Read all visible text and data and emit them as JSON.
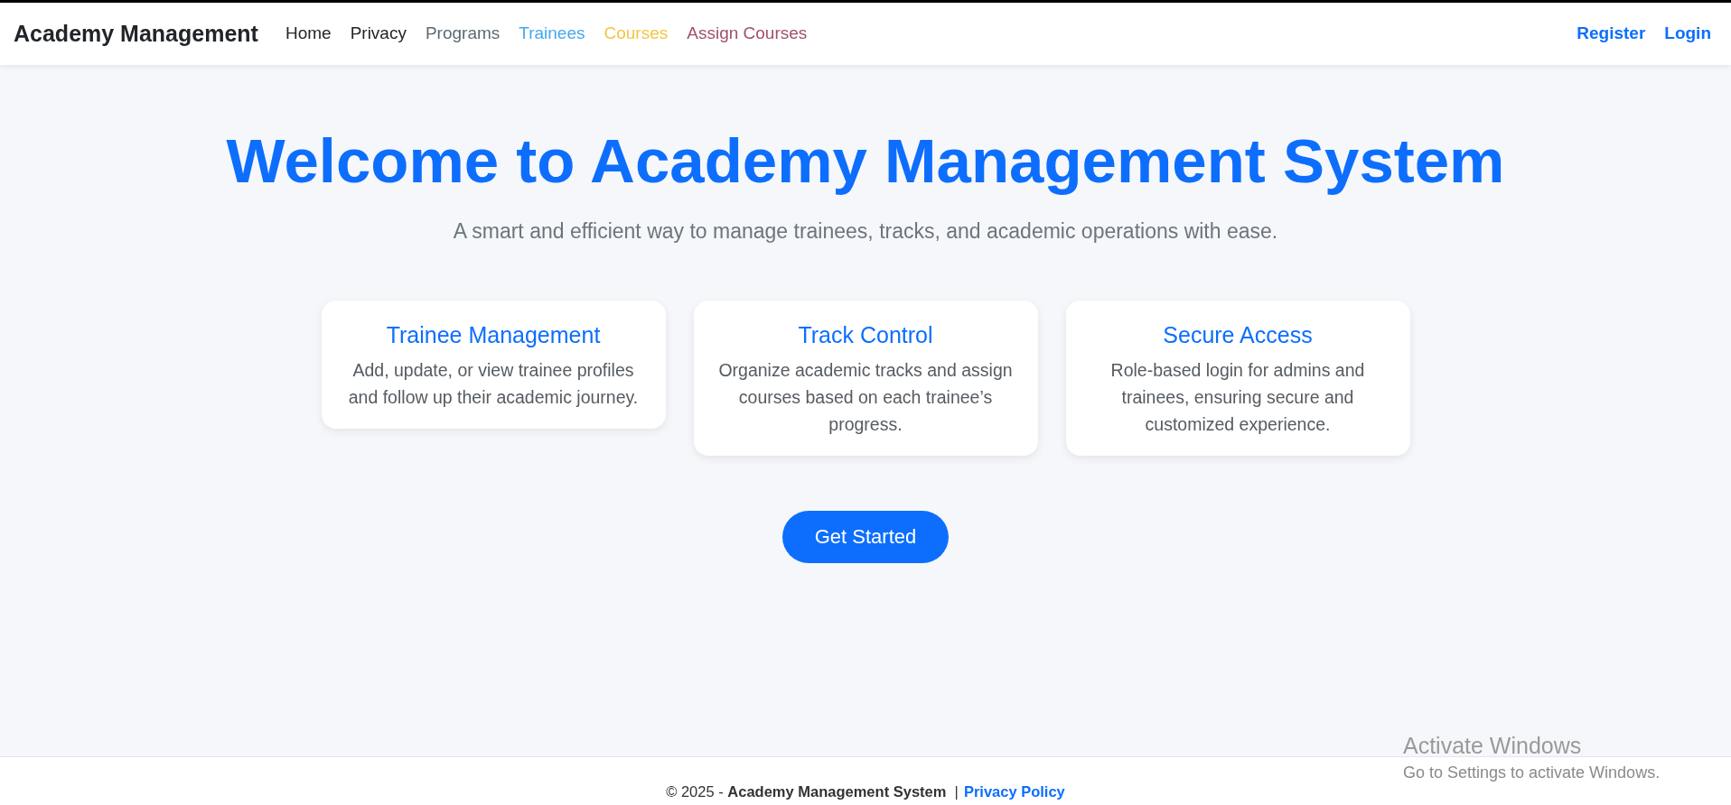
{
  "navbar": {
    "brand": "Academy Management",
    "links": [
      {
        "label": "Home",
        "color": "#212529"
      },
      {
        "label": "Privacy",
        "color": "#212529"
      },
      {
        "label": "Programs",
        "color": "#5a6a72"
      },
      {
        "label": "Trainees",
        "color": "#45a8f0"
      },
      {
        "label": "Courses",
        "color": "#f2c544"
      },
      {
        "label": "Assign Courses",
        "color": "#a0506a"
      }
    ],
    "auth_links": [
      "Register",
      "Login"
    ]
  },
  "hero": {
    "title": "Welcome to Academy Management System",
    "subtitle": "A smart and efficient way to manage trainees, tracks, and academic operations with ease.",
    "features": [
      {
        "title": "Trainee Management",
        "description": "Add, update, or view trainee profiles and follow up their academic journey."
      },
      {
        "title": "Track Control",
        "description": "Organize academic tracks and assign courses based on each trainee’s progress."
      },
      {
        "title": "Secure Access",
        "description": "Role-based login for admins and trainees, ensuring secure and customized experience."
      }
    ],
    "button": "Get Started"
  },
  "footer": {
    "text": "© 2025 - **Academy Management System**  |",
    "link": "Privacy Policy"
  },
  "os_notice": {
    "title": "Activate Windows",
    "text": "Go to Settings to activate Windows."
  }
}
